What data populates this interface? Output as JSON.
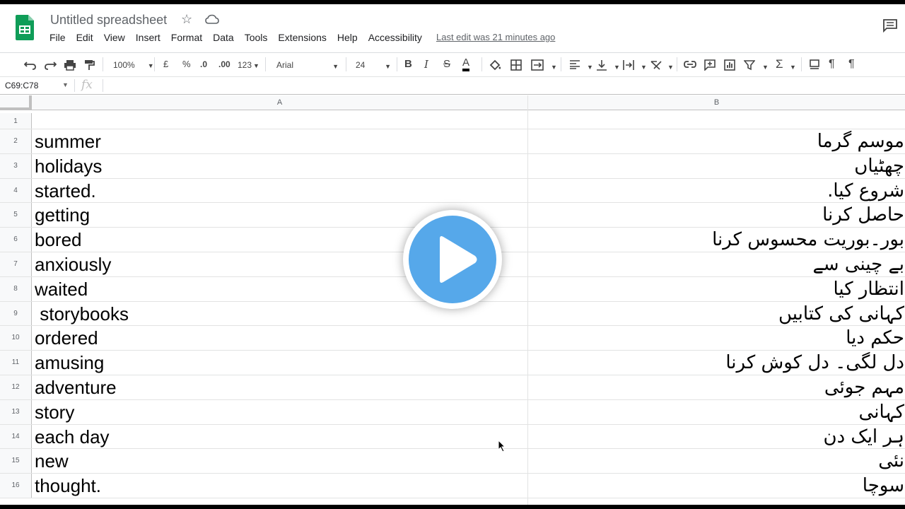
{
  "app": {
    "title": "Untitled spreadsheet",
    "last_edit": "Last edit was 21 minutes ago"
  },
  "menu": [
    "File",
    "Edit",
    "View",
    "Insert",
    "Format",
    "Data",
    "Tools",
    "Extensions",
    "Help",
    "Accessibility"
  ],
  "toolbar": {
    "zoom": "100%",
    "currency": "£",
    "percent": "%",
    "decrease_decimal": ".0",
    "increase_decimal": ".00",
    "more_formats": "123",
    "font": "Arial",
    "font_size": "24",
    "bold": "B",
    "italic": "I",
    "strike": "S",
    "text_color": "A"
  },
  "formula": {
    "namebox": "C69:C78",
    "fx": "fx"
  },
  "columns": [
    "A",
    "B"
  ],
  "rows": [
    {
      "num": "1",
      "a": "",
      "b": ""
    },
    {
      "num": "2",
      "a": "summer",
      "b": "موسم گرما"
    },
    {
      "num": "3",
      "a": "holidays",
      "b": "چھٹیاں"
    },
    {
      "num": "4",
      "a": "started.",
      "b": "شروع کیا."
    },
    {
      "num": "5",
      "a": "getting",
      "b": "حاصل کرنا"
    },
    {
      "num": "6",
      "a": "bored",
      "b": "بور۔بوریت محسوس کرنا"
    },
    {
      "num": "7",
      "a": "anxiously",
      "b": "بے چینی سے"
    },
    {
      "num": "8",
      "a": "waited",
      "b": "انتظار کیا"
    },
    {
      "num": "9",
      "a": " storybooks",
      "b": "کہانی کی کتابیں "
    },
    {
      "num": "10",
      "a": "ordered",
      "b": "حکم دیا"
    },
    {
      "num": "11",
      "a": "amusing",
      "b": "دل لگی۔ دل کوش کرنا"
    },
    {
      "num": "12",
      "a": "adventure",
      "b": "مہم جوئی"
    },
    {
      "num": "13",
      "a": "story",
      "b": "کہانی"
    },
    {
      "num": "14",
      "a": "each day",
      "b": "ہر ایک دن"
    },
    {
      "num": "15",
      "a": "new",
      "b": "نئی"
    },
    {
      "num": "16",
      "a": "thought.",
      "b": "سوچا"
    }
  ],
  "colors": {
    "sheets_green": "#0f9d58",
    "play_blue": "#56a8ea",
    "header_bg": "#f8f9fa"
  }
}
